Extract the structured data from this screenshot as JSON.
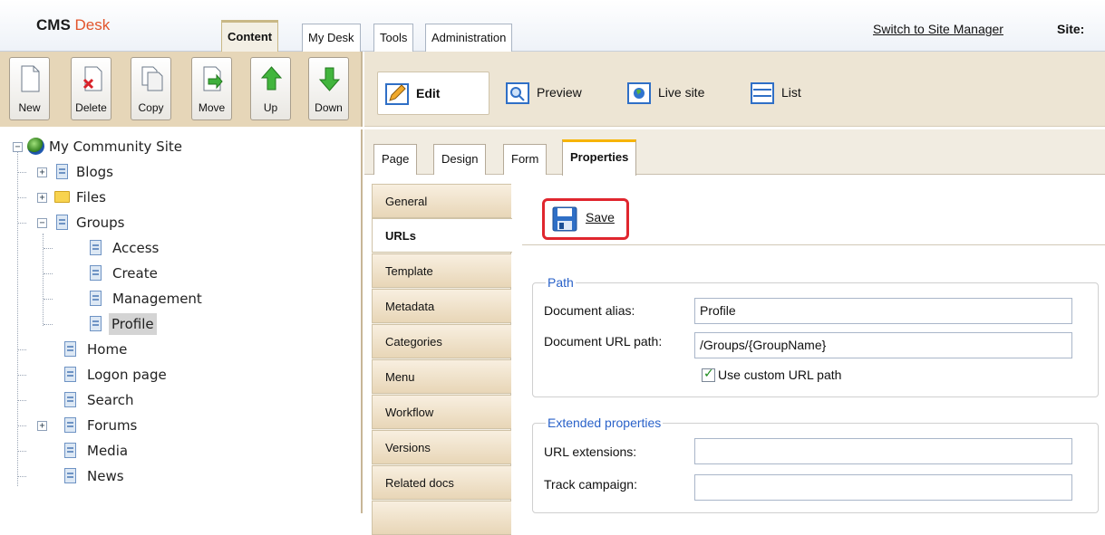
{
  "app": {
    "logo_part1": "CMS",
    "logo_part2": "Desk",
    "switch_link": "Switch to Site Manager",
    "site_label": "Site:"
  },
  "top_tabs": [
    {
      "label": "Content",
      "active": true
    },
    {
      "label": "My Desk"
    },
    {
      "label": "Tools"
    },
    {
      "label": "Administration"
    }
  ],
  "toolbar": {
    "new": "New",
    "delete": "Delete",
    "copy": "Copy",
    "move": "Move",
    "up": "Up",
    "down": "Down"
  },
  "view_modes": {
    "edit": "Edit",
    "preview": "Preview",
    "live_site": "Live site",
    "list": "List"
  },
  "tree": {
    "root": "My Community Site",
    "items": [
      "Blogs",
      "Files",
      "Groups",
      "Access",
      "Create",
      "Management",
      "Profile",
      "Home",
      "Logon page",
      "Search",
      "Forums",
      "Media",
      "News"
    ],
    "selected": "Profile"
  },
  "content_tabs": [
    "Page",
    "Design",
    "Form",
    "Properties"
  ],
  "property_tabs": [
    "General",
    "URLs",
    "Template",
    "Metadata",
    "Categories",
    "Menu",
    "Workflow",
    "Versions",
    "Related docs"
  ],
  "active_property_tab": "URLs",
  "save_label": "Save",
  "path_group": {
    "legend": "Path",
    "alias_label": "Document alias:",
    "alias_value": "Profile",
    "url_path_label": "Document URL path:",
    "url_path_value": "/Groups/{GroupName}",
    "custom_url_label": "Use custom URL path",
    "custom_url_checked": true
  },
  "extended_group": {
    "legend": "Extended properties",
    "url_ext_label": "URL extensions:",
    "url_ext_value": "",
    "track_label": "Track campaign:",
    "track_value": ""
  },
  "colors": {
    "accent_tab": "#f7b400",
    "logo_desk": "#e2542b",
    "save_highlight": "#e0262e",
    "legend_text": "#2a62c9"
  }
}
